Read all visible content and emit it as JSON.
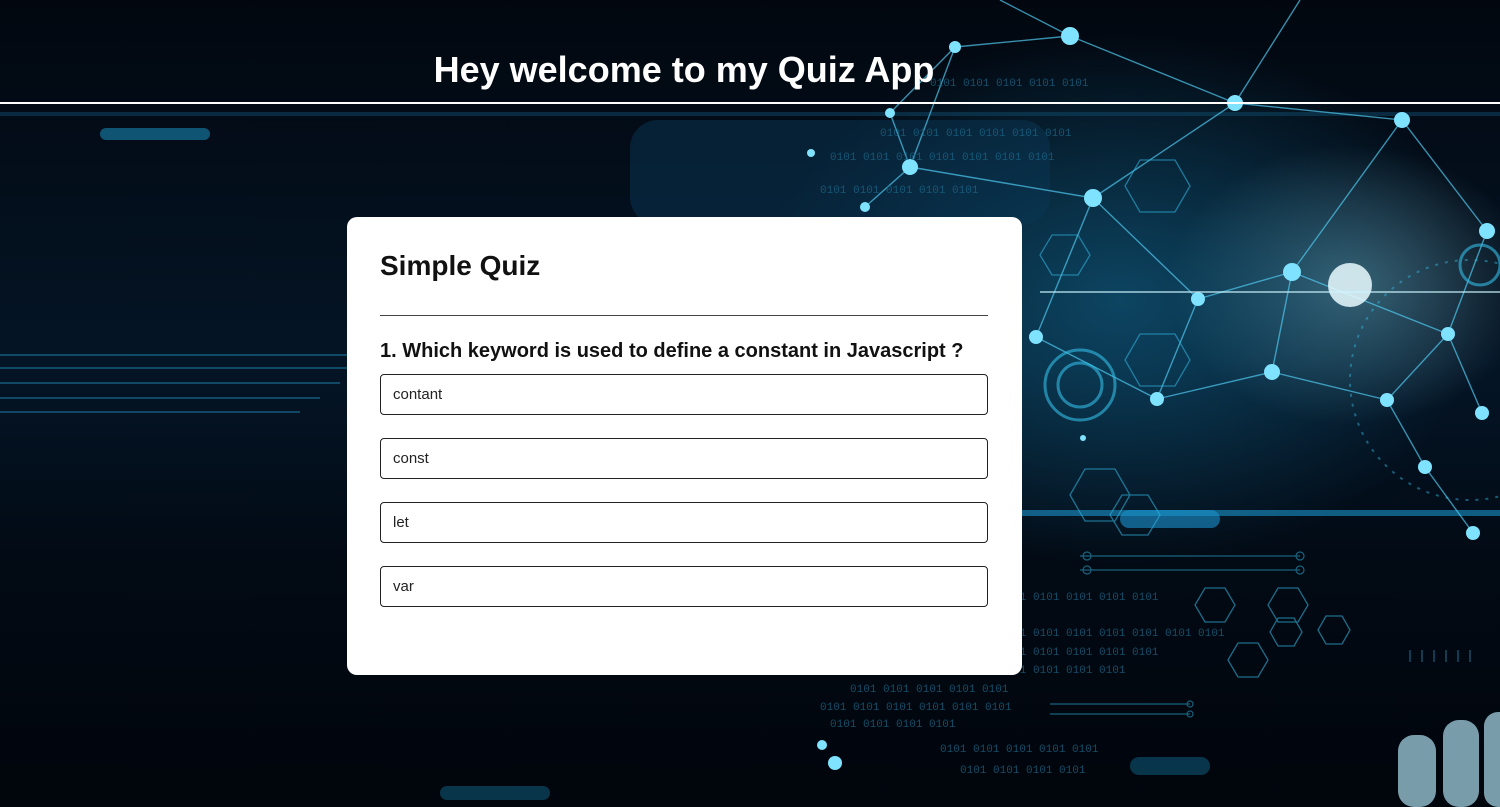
{
  "header": {
    "title": "Hey welcome to my Quiz App"
  },
  "quiz": {
    "title": "Simple Quiz",
    "question": "1. Which keyword is used to define a constant in Javascript ?",
    "options": [
      {
        "label": "contant"
      },
      {
        "label": "const"
      },
      {
        "label": "let"
      },
      {
        "label": "var"
      }
    ]
  },
  "colors": {
    "background": "#030a16",
    "card": "#ffffff",
    "accent_glow": "#38c8f0",
    "text_dark": "#111111",
    "header_text": "#ffffff"
  },
  "icons": [
    "tech-network-background"
  ]
}
